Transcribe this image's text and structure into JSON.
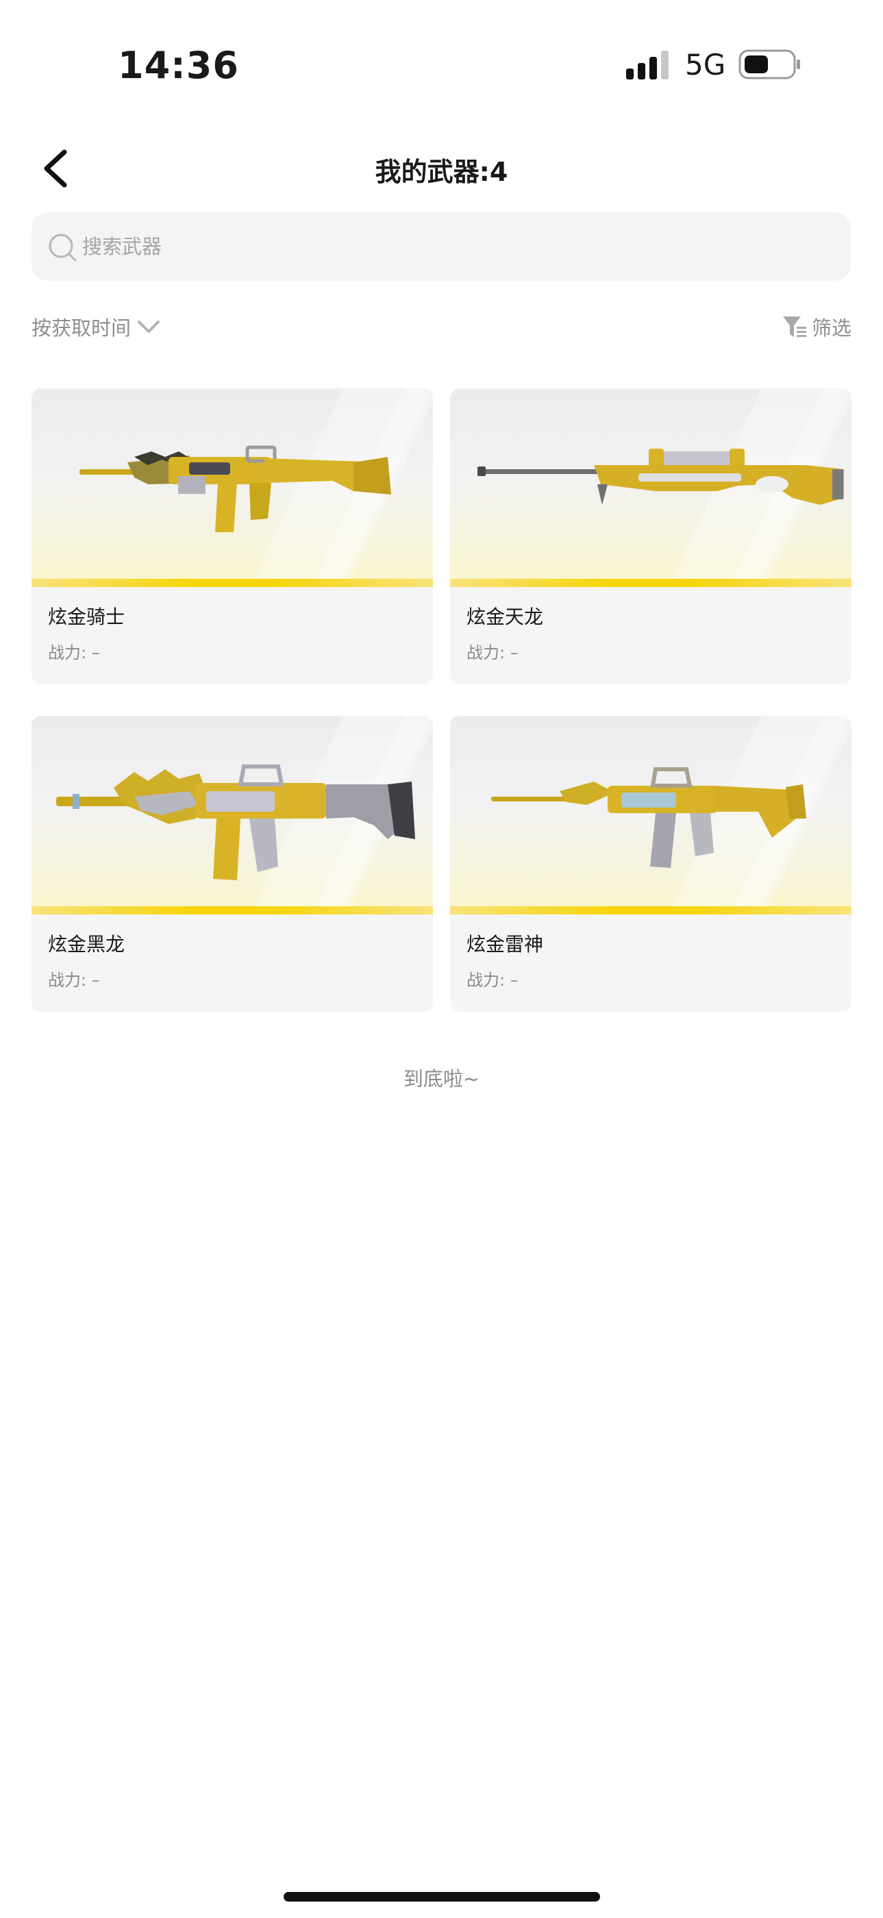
{
  "status_bar": {
    "time": "14:36",
    "network": "5G"
  },
  "header": {
    "title": "我的武器:4"
  },
  "search": {
    "placeholder": "搜索武器",
    "value": ""
  },
  "toolbar": {
    "sort_label": "按获取时间",
    "filter_label": "筛选"
  },
  "weapons": [
    {
      "name": "炫金骑士",
      "power": "战力: –"
    },
    {
      "name": "炫金天龙",
      "power": "战力: –"
    },
    {
      "name": "炫金黑龙",
      "power": "战力: –"
    },
    {
      "name": "炫金雷神",
      "power": "战力: –"
    }
  ],
  "footer": {
    "end_text": "到底啦~"
  },
  "colors": {
    "accent": "#f6d50a",
    "gold": "#d4b21e"
  }
}
